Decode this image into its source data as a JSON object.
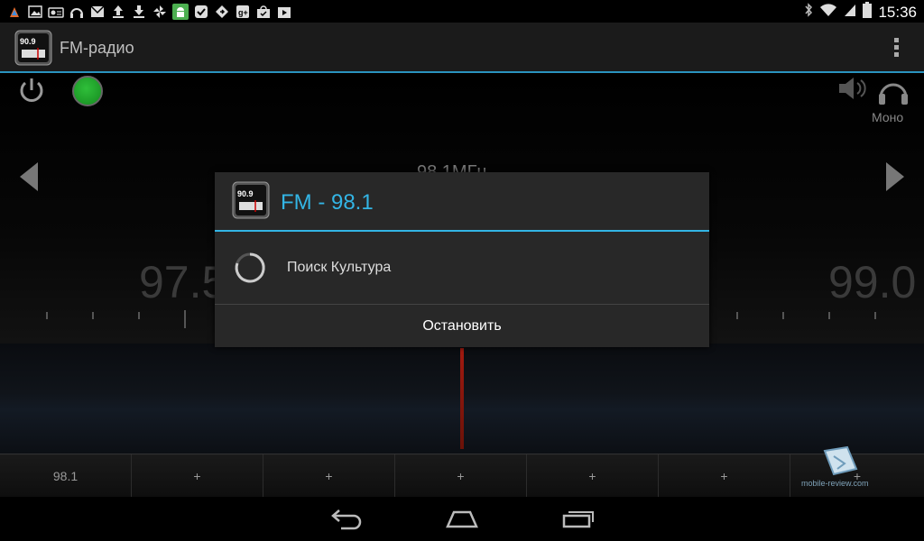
{
  "status_bar": {
    "time": "15:36",
    "notification_icons": [
      "app-icon",
      "image-icon",
      "radio-icon",
      "headphones-icon",
      "gmail-icon",
      "upload-icon",
      "download-icon",
      "pinwheel-icon",
      "android-icon",
      "check-icon",
      "share-icon",
      "google-plus-icon",
      "bag-icon",
      "play-store-icon"
    ],
    "right_icons": [
      "bluetooth-icon",
      "wifi-icon",
      "signal-icon",
      "battery-icon"
    ]
  },
  "app_bar": {
    "title": "FM-радио",
    "icon_label": "90.9"
  },
  "radio": {
    "mode_label": "Моно",
    "center_frequency": "98.1МГц",
    "left_frequency": "97.5",
    "right_frequency": "99.0"
  },
  "dialog": {
    "title": "FM - 98.1",
    "icon_label": "90.9",
    "message": "Поиск Культура",
    "button": "Остановить"
  },
  "presets": [
    "98.1",
    "+",
    "+",
    "+",
    "+",
    "+",
    "+"
  ],
  "watermark": {
    "text": "mobile-review.com"
  },
  "colors": {
    "accent": "#33b5e5",
    "status_green": "#1fa82a",
    "needle_red": "#a21a10"
  }
}
